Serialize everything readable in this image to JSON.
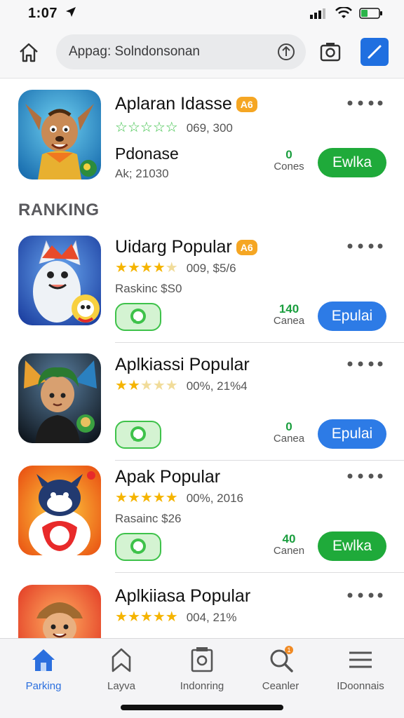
{
  "status": {
    "time": "1:07"
  },
  "top_bar": {
    "search_text": "Appag: Solndonsonan"
  },
  "featured": {
    "title": "Aplaran Idasse",
    "badge": "A6",
    "rating_stars": 0,
    "rating_text": "069, 300",
    "subtitle": "Pdonase",
    "meta": "Ak; 21030",
    "count": "0",
    "count_label": "Cones",
    "action_label": "Ewlka"
  },
  "section_heading": "RANKING",
  "ranking": [
    {
      "title": "Uidarg Popular",
      "badge": "A6",
      "rating_stars": 4,
      "rating_text": "009, $5/6",
      "meta": "Raskinc $S0",
      "count": "140",
      "count_label": "Canea",
      "action_label": "Epulai",
      "action_color": "#2d7be6"
    },
    {
      "title": "Aplkiassi Popular",
      "badge": "",
      "rating_stars": 2,
      "rating_text": "00%, 21%4",
      "meta": "",
      "count": "0",
      "count_label": "Canea",
      "action_label": "Epulai",
      "action_color": "#2d7be6"
    },
    {
      "title": "Apak Popular",
      "badge": "",
      "rating_stars": 5,
      "rating_text": "00%, 2016",
      "meta": "Rasainc $26",
      "count": "40",
      "count_label": "Canen",
      "action_label": "Ewlka",
      "action_color": "#1faa3a"
    },
    {
      "title": "Aplkiiasa Popular",
      "badge": "",
      "rating_stars": 5,
      "rating_text": "004, 21%",
      "meta": "",
      "count": "",
      "count_label": "",
      "action_label": "",
      "action_color": ""
    }
  ],
  "tabs": [
    {
      "label": "Parking",
      "icon": "home-icon"
    },
    {
      "label": "Layva",
      "icon": "bookmark-icon"
    },
    {
      "label": "Indonring",
      "icon": "frame-icon"
    },
    {
      "label": "Ceanler",
      "icon": "search-icon",
      "badge": "1"
    },
    {
      "label": "IDoonnais",
      "icon": "menu-icon"
    }
  ],
  "colors": {
    "accent_blue": "#2d7be6",
    "accent_green": "#1faa3a",
    "star_gold": "#f5b400",
    "badge_orange": "#f5a623"
  }
}
